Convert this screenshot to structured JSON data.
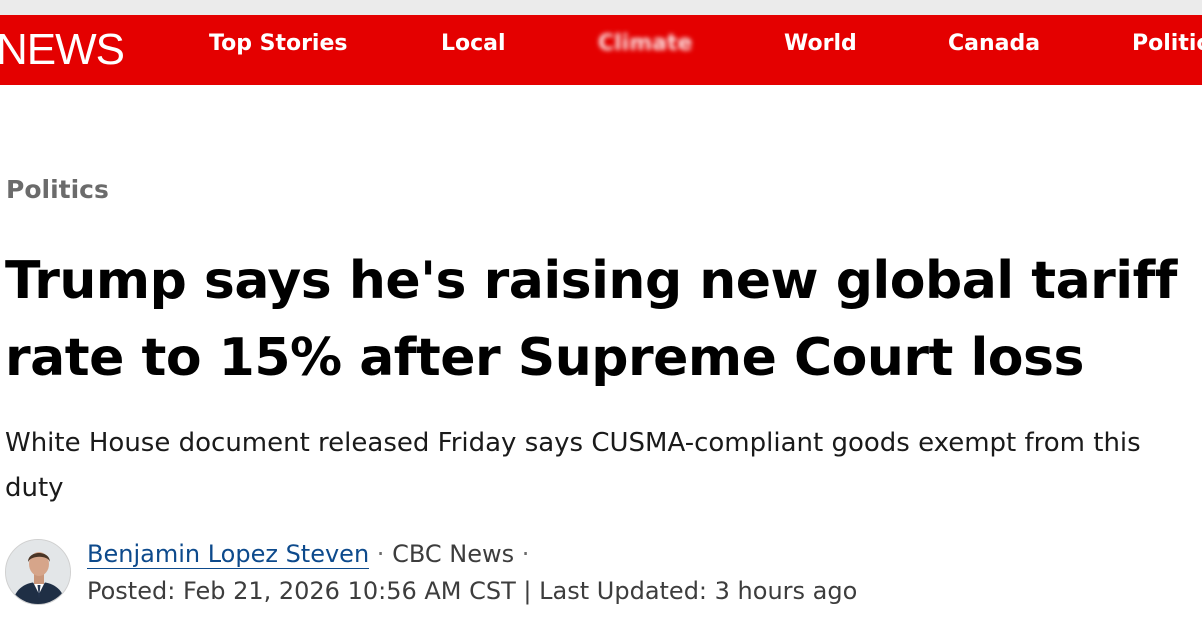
{
  "header": {
    "logo_text": "NEWS",
    "brand_color": "#e40000",
    "nav": [
      {
        "label": "Top Stories"
      },
      {
        "label": "Local"
      },
      {
        "label": "Climate"
      },
      {
        "label": "World"
      },
      {
        "label": "Canada"
      },
      {
        "label": "Politics"
      }
    ]
  },
  "article": {
    "category": "Politics",
    "headline": "Trump says he's raising new global tariff rate to 15% after Supreme Court loss",
    "subheadline": "White House document released Friday says CUSMA-compliant goods exempt from this duty",
    "byline": {
      "author": "Benjamin Lopez Steven",
      "separator": "·",
      "source": "CBC News",
      "posted_label": "Posted:",
      "posted": "Feb 21, 2026 10:56 AM CST",
      "divider": "|",
      "updated_label": "Last Updated:",
      "updated": "3 hours ago"
    }
  }
}
